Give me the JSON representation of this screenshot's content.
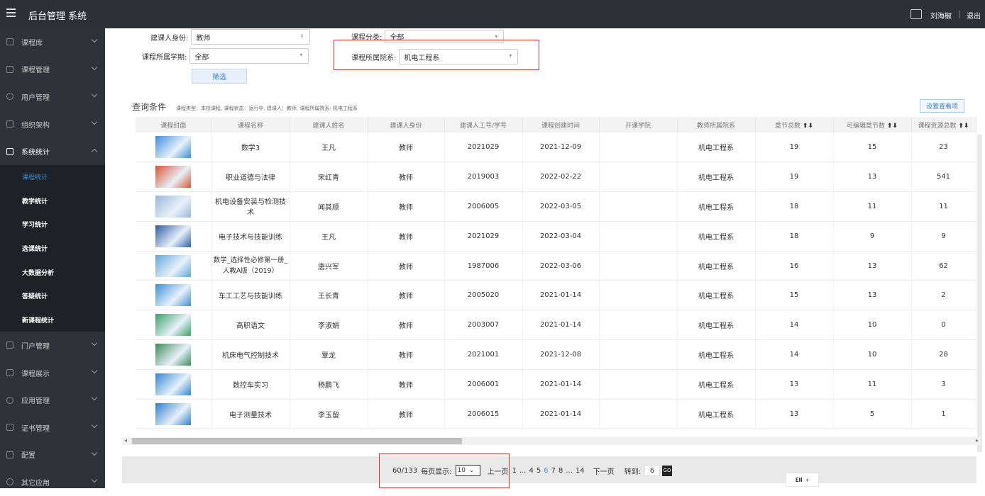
{
  "header": {
    "title": "后台管理 系统",
    "user": "刘海椒",
    "separator": "|",
    "logout": "退出"
  },
  "sidebar": {
    "items_top": [
      {
        "label": "课程库"
      },
      {
        "label": "课程管理"
      },
      {
        "label": "用户管理"
      },
      {
        "label": "组织架构"
      },
      {
        "label": "系统统计"
      }
    ],
    "sub_items": [
      {
        "label": "课程统计",
        "active": true
      },
      {
        "label": "教学统计"
      },
      {
        "label": "学习统计"
      },
      {
        "label": "选课统计"
      },
      {
        "label": "大数据分析"
      },
      {
        "label": "答疑统计"
      },
      {
        "label": "新课程统计"
      }
    ],
    "items_bottom": [
      {
        "label": "门户管理"
      },
      {
        "label": "课程展示"
      },
      {
        "label": "应用管理"
      },
      {
        "label": "证书管理"
      },
      {
        "label": "配置"
      },
      {
        "label": "其它应用"
      }
    ]
  },
  "filters": {
    "creator_identity_label": "建课人身份:",
    "creator_identity_value": "教师",
    "course_category_label": "课程分类:",
    "course_category_value": "全部",
    "semester_label": "课程所属学期:",
    "semester_value": "全部",
    "college_label": "课程所属院系:",
    "college_value": "机电工程系",
    "filter_button": "筛选"
  },
  "conditions": {
    "label": "查询条件",
    "text": "课程类型：本校课程, 课程状态：运行中, 建课人：教师, 课程所属院系: 机电工程系",
    "settings_button": "设置查看项"
  },
  "table": {
    "headers": [
      "课程封面",
      "课程名称",
      "建课人姓名",
      "建课人身份",
      "建课人工号/学号",
      "课程创建时间",
      "开课学院",
      "教师所属院系",
      "章节总数",
      "可编辑章节数",
      "课程资源总数"
    ],
    "sort_icon": "⬆⬇",
    "rows": [
      {
        "name": "数学3",
        "creator": "王凡",
        "identity": "教师",
        "id": "2021029",
        "created": "2021-12-09",
        "college": "",
        "dept": "机电工程系",
        "chapters": "19",
        "editable": "15",
        "resources": "23"
      },
      {
        "name": "职业道德与法律",
        "creator": "宋红青",
        "identity": "教师",
        "id": "2019003",
        "created": "2022-02-22",
        "college": "",
        "dept": "机电工程系",
        "chapters": "19",
        "editable": "13",
        "resources": "541"
      },
      {
        "name": "机电设备安装与检测技术",
        "creator": "闻其顺",
        "identity": "教师",
        "id": "2006005",
        "created": "2022-03-05",
        "college": "",
        "dept": "机电工程系",
        "chapters": "18",
        "editable": "11",
        "resources": "11"
      },
      {
        "name": "电子技术与技能训练",
        "creator": "王凡",
        "identity": "教师",
        "id": "2021029",
        "created": "2022-03-04",
        "college": "",
        "dept": "机电工程系",
        "chapters": "18",
        "editable": "9",
        "resources": "9"
      },
      {
        "name": "数学_选择性必修第一册_人教A版（2019）",
        "creator": "唐兴军",
        "identity": "教师",
        "id": "1987006",
        "created": "2022-03-06",
        "college": "",
        "dept": "机电工程系",
        "chapters": "16",
        "editable": "13",
        "resources": "62"
      },
      {
        "name": "车工工艺与技能训练",
        "creator": "王长青",
        "identity": "教师",
        "id": "2005020",
        "created": "2021-01-14",
        "college": "",
        "dept": "机电工程系",
        "chapters": "15",
        "editable": "13",
        "resources": "2"
      },
      {
        "name": "高职语文",
        "creator": "李淑娟",
        "identity": "教师",
        "id": "2003007",
        "created": "2021-01-14",
        "college": "",
        "dept": "机电工程系",
        "chapters": "14",
        "editable": "10",
        "resources": "0"
      },
      {
        "name": "机床电气控制技术",
        "creator": "覃龙",
        "identity": "教师",
        "id": "2021001",
        "created": "2021-12-08",
        "college": "",
        "dept": "机电工程系",
        "chapters": "14",
        "editable": "10",
        "resources": "28"
      },
      {
        "name": "数控车实习",
        "creator": "杨鹏飞",
        "identity": "教师",
        "id": "2006001",
        "created": "2021-01-14",
        "college": "",
        "dept": "机电工程系",
        "chapters": "13",
        "editable": "11",
        "resources": "3"
      },
      {
        "name": "电子测量技术",
        "creator": "李玉留",
        "identity": "教师",
        "id": "2006015",
        "created": "2021-01-14",
        "college": "",
        "dept": "机电工程系",
        "chapters": "13",
        "editable": "5",
        "resources": "1"
      }
    ]
  },
  "pagination": {
    "summary": "60/133",
    "per_page_label": "每页显示:",
    "per_page_value": "10",
    "prev": "上一页",
    "pages": [
      "1",
      "...",
      "4",
      "5",
      "6",
      "7",
      "8",
      "...",
      "14"
    ],
    "current": "6",
    "next": "下一页",
    "goto_label": "转到:",
    "goto_value": "6",
    "go": "GO"
  },
  "ime": "EN"
}
